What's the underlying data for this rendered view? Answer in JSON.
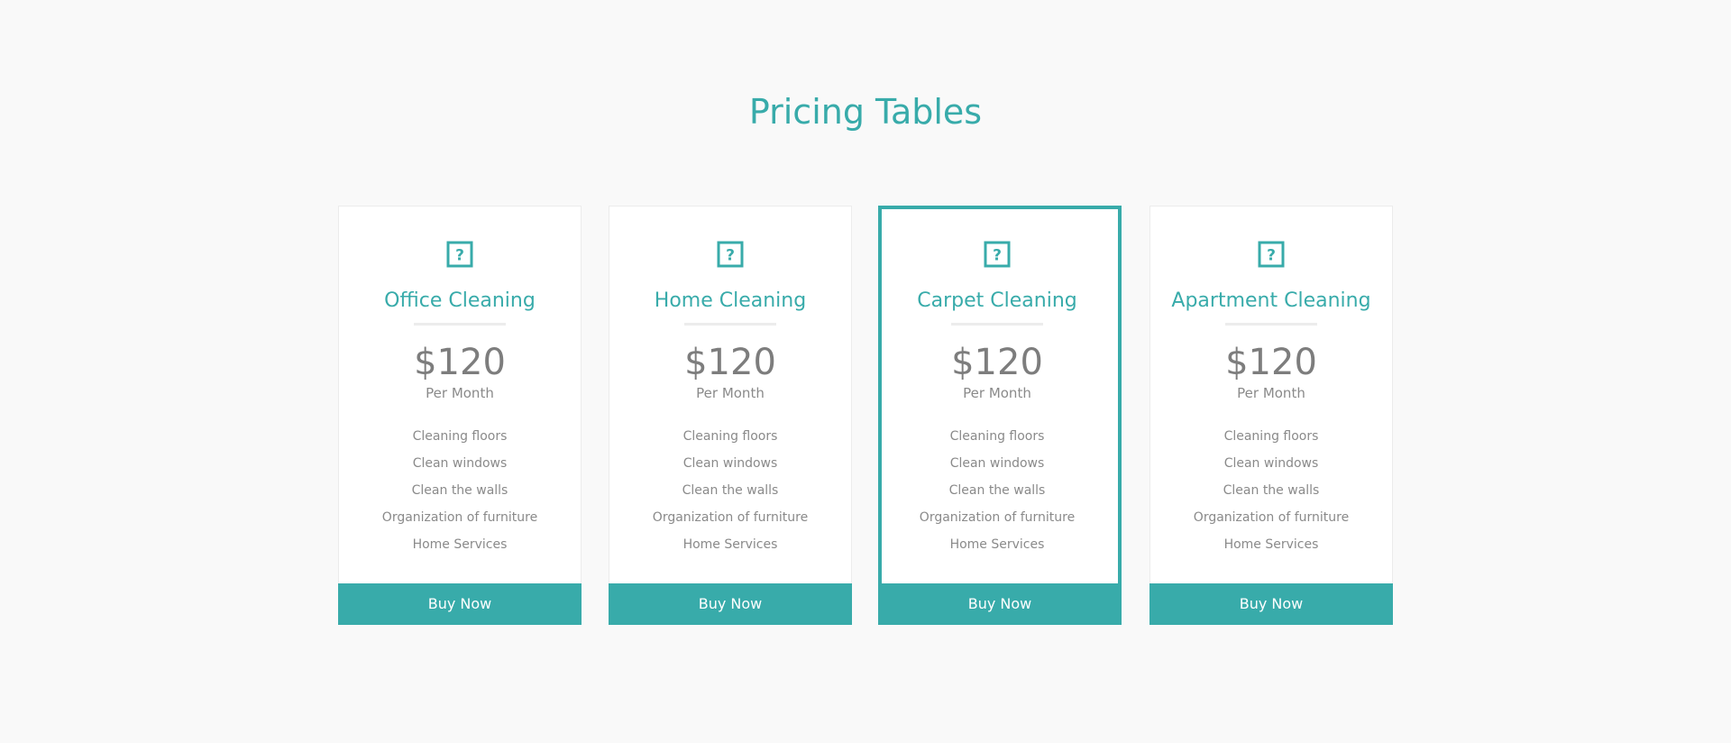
{
  "page": {
    "title": "Pricing Tables",
    "accent_color": "#38abaa"
  },
  "plans": [
    {
      "icon": "question-square-icon",
      "name": "Office Cleaning",
      "price": "$120",
      "period": "Per Month",
      "features": [
        "Cleaning floors",
        "Clean windows",
        "Clean the walls",
        "Organization of furniture",
        "Home Services"
      ],
      "button_label": "Buy Now",
      "featured": false
    },
    {
      "icon": "question-square-icon",
      "name": "Home Cleaning",
      "price": "$120",
      "period": "Per Month",
      "features": [
        "Cleaning floors",
        "Clean windows",
        "Clean the walls",
        "Organization of furniture",
        "Home Services"
      ],
      "button_label": "Buy Now",
      "featured": false
    },
    {
      "icon": "question-square-icon",
      "name": "Carpet Cleaning",
      "price": "$120",
      "period": "Per Month",
      "features": [
        "Cleaning floors",
        "Clean windows",
        "Clean the walls",
        "Organization of furniture",
        "Home Services"
      ],
      "button_label": "Buy Now",
      "featured": true
    },
    {
      "icon": "question-square-icon",
      "name": "Apartment Cleaning",
      "price": "$120",
      "period": "Per Month",
      "features": [
        "Cleaning floors",
        "Clean windows",
        "Clean the walls",
        "Organization of furniture",
        "Home Services"
      ],
      "button_label": "Buy Now",
      "featured": false
    }
  ]
}
